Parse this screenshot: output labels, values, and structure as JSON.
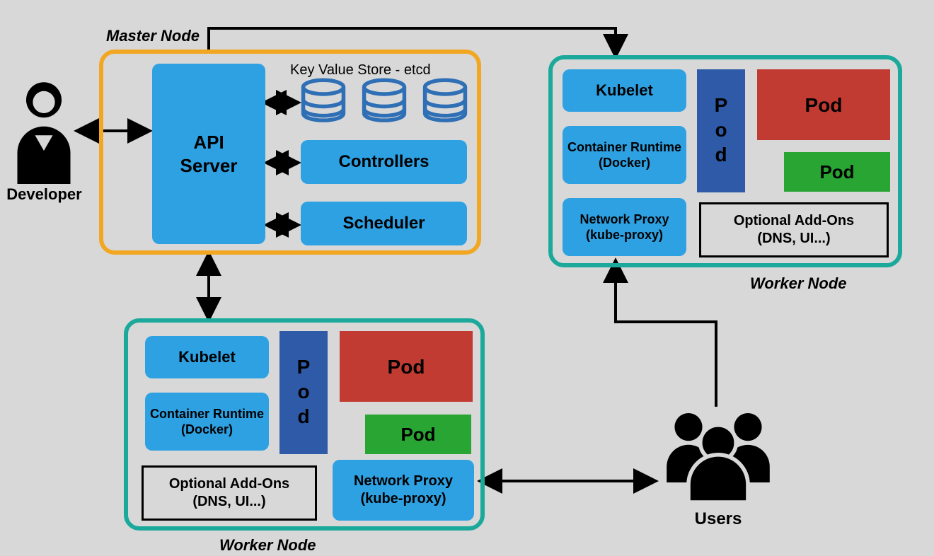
{
  "labels": {
    "developer": "Developer",
    "users": "Users",
    "master_node": "Master Node",
    "worker_node": "Worker Node",
    "etcd": "Key Value Store - etcd"
  },
  "master": {
    "api_server": "API\nServer",
    "controllers": "Controllers",
    "scheduler": "Scheduler"
  },
  "worker": {
    "kubelet": "Kubelet",
    "runtime": "Container Runtime\n(Docker)",
    "proxy": "Network Proxy\n(kube-proxy)",
    "addons": "Optional Add-Ons\n(DNS, UI...)",
    "pod": "Pod"
  },
  "colors": {
    "blue": "#2ea1e3",
    "darkblue": "#2e5aa8",
    "red": "#c23b32",
    "green": "#28a532",
    "orange": "#f2a722",
    "teal": "#1aa99a"
  }
}
